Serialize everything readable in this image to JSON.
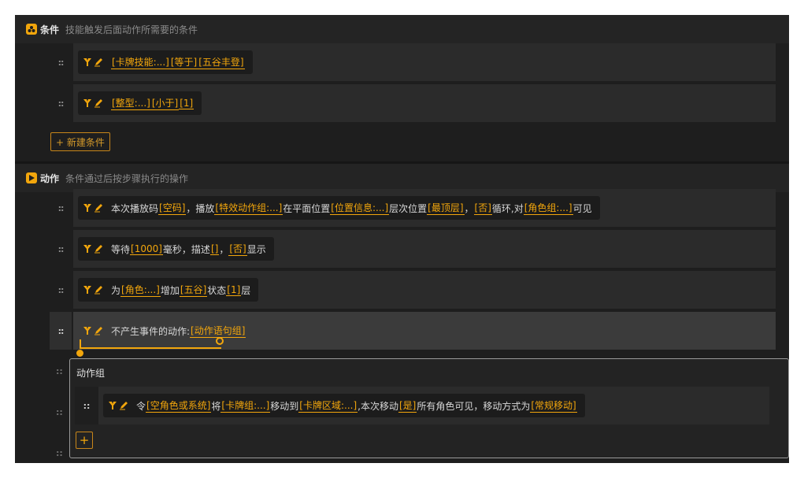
{
  "conditions": {
    "title": "条件",
    "description": "技能触发后面动作所需要的条件",
    "items": [
      {
        "parts": [
          {
            "t": "tok",
            "v": "[卡牌技能:...]"
          },
          {
            "t": "tok",
            "v": "[等于]"
          },
          {
            "t": "tok",
            "v": "[五谷丰登]"
          }
        ]
      },
      {
        "parts": [
          {
            "t": "tok",
            "v": "[整型:...]"
          },
          {
            "t": "tok",
            "v": "[小于]"
          },
          {
            "t": "tok",
            "v": "[1]"
          }
        ]
      }
    ],
    "new_button": "+ 新建条件"
  },
  "actions": {
    "title": "动作",
    "description": "条件通过后按步骤执行的操作",
    "items": [
      {
        "parts": [
          {
            "t": "txt",
            "v": "本次播放码"
          },
          {
            "t": "tok",
            "v": "[空码]"
          },
          {
            "t": "txt",
            "v": "，播放"
          },
          {
            "t": "tok",
            "v": "[特效动作组:...]"
          },
          {
            "t": "txt",
            "v": "在平面位置"
          },
          {
            "t": "tok",
            "v": "[位置信息:...]"
          },
          {
            "t": "txt",
            "v": "层次位置"
          },
          {
            "t": "tok",
            "v": "[最顶层]"
          },
          {
            "t": "txt",
            "v": "，"
          },
          {
            "t": "tok",
            "v": "[否]"
          },
          {
            "t": "txt",
            "v": "循环,对"
          },
          {
            "t": "tok",
            "v": "[角色组:...]"
          },
          {
            "t": "txt",
            "v": "可见"
          }
        ]
      },
      {
        "parts": [
          {
            "t": "txt",
            "v": "等待"
          },
          {
            "t": "tok",
            "v": "[1000]"
          },
          {
            "t": "txt",
            "v": "毫秒，描述"
          },
          {
            "t": "tok",
            "v": "[]"
          },
          {
            "t": "txt",
            "v": "，"
          },
          {
            "t": "tok",
            "v": "[否]"
          },
          {
            "t": "txt",
            "v": "显示"
          }
        ]
      },
      {
        "parts": [
          {
            "t": "txt",
            "v": "为"
          },
          {
            "t": "tok",
            "v": "[角色:...]"
          },
          {
            "t": "txt",
            "v": "增加"
          },
          {
            "t": "tok",
            "v": "[五谷]"
          },
          {
            "t": "txt",
            "v": "状态"
          },
          {
            "t": "tok",
            "v": "[1]"
          },
          {
            "t": "txt",
            "v": "层"
          }
        ]
      },
      {
        "parts": [
          {
            "t": "txt",
            "v": "不产生事件的动作:"
          },
          {
            "t": "tok",
            "v": "[动作语句组]"
          }
        ]
      }
    ]
  },
  "action_group_popup": {
    "title": "动作组",
    "item": {
      "parts": [
        {
          "t": "txt",
          "v": "令"
        },
        {
          "t": "tok",
          "v": "[空角色或系统]"
        },
        {
          "t": "txt",
          "v": "将"
        },
        {
          "t": "tok",
          "v": "[卡牌组:...]"
        },
        {
          "t": "txt",
          "v": "移动到"
        },
        {
          "t": "tok",
          "v": "[卡牌区域:...]"
        },
        {
          "t": "txt",
          "v": ",本次移动"
        },
        {
          "t": "tok",
          "v": "[是]"
        },
        {
          "t": "txt",
          "v": "所有角色可见，移动方式为"
        },
        {
          "t": "tok",
          "v": "[常规移动]"
        }
      ]
    },
    "add_button": "+"
  },
  "handle_glyph": "::",
  "colors": {
    "accent": "#f2a60c",
    "background": "#1e1e1e",
    "row": "#2b2b2b"
  }
}
